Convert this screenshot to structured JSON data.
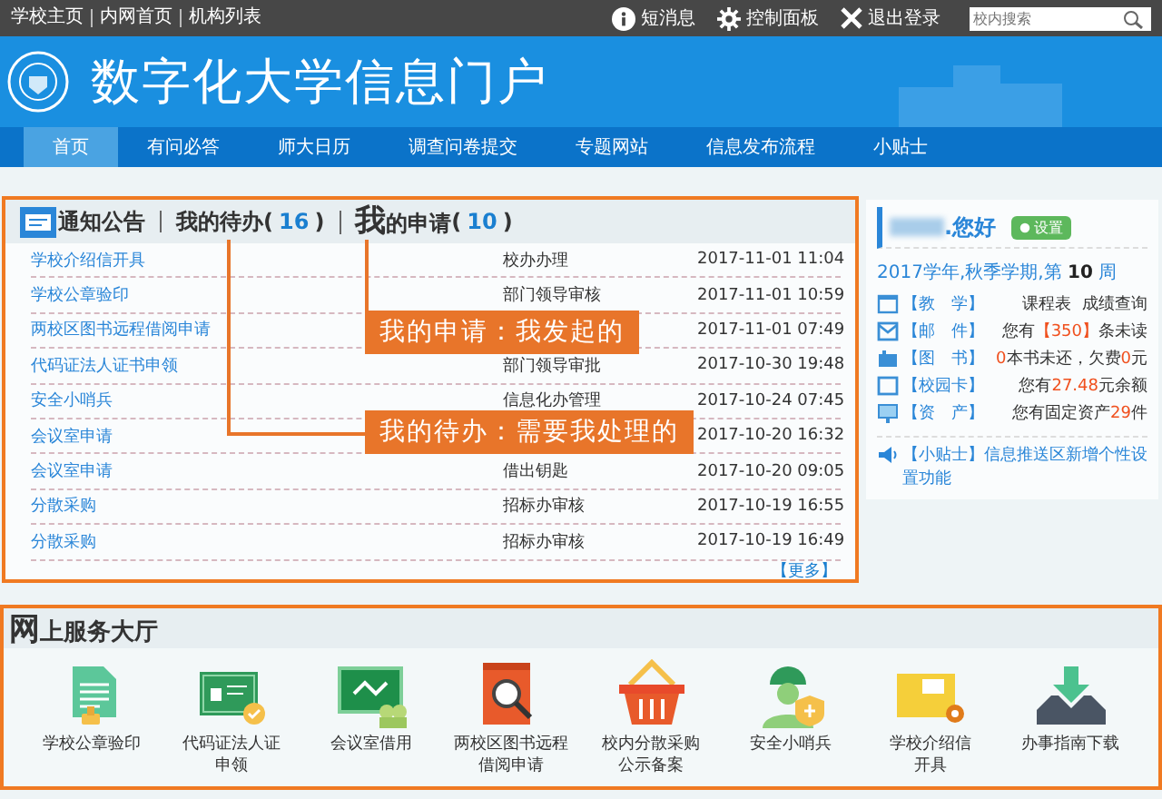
{
  "top_links": [
    "学校主页",
    "内网首页",
    "机构列表"
  ],
  "top_actions": [
    {
      "kind": "info",
      "label": "短消息"
    },
    {
      "kind": "gear",
      "label": "控制面板"
    },
    {
      "kind": "close",
      "label": "退出登录"
    }
  ],
  "search": {
    "placeholder": "校内搜索"
  },
  "banner": {
    "title": "数字化大学信息门户"
  },
  "nav": [
    {
      "label": "首页",
      "selected": true
    },
    {
      "label": "有问必答",
      "selected": false
    },
    {
      "label": "师大日历",
      "selected": false
    },
    {
      "label": "调查问卷提交",
      "selected": false
    },
    {
      "label": "专题网站",
      "selected": false
    },
    {
      "label": "信息发布流程",
      "selected": false
    },
    {
      "label": "小贴士",
      "selected": false
    }
  ],
  "tabs": [
    {
      "label": "通知公告",
      "icon": true,
      "selected": false
    },
    {
      "label": "我的待办",
      "brackets": [
        "(",
        ")"
      ],
      "count": "16",
      "selected": false
    },
    {
      "label": "我的申请",
      "brackets": [
        "(",
        ")"
      ],
      "count": "10",
      "selected": true
    }
  ],
  "rows": [
    {
      "title": "学校介绍信开具",
      "status": "校办办理",
      "time": "2017-11-01 11:04"
    },
    {
      "title": "学校公章验印",
      "status": "部门领导审核",
      "time": "2017-11-01 10:59"
    },
    {
      "title": "两校区图书远程借阅申请",
      "time": "2017-11-01 07:49"
    },
    {
      "title": "代码证法人证书申领",
      "status": "部门领导审批",
      "time": "2017-10-30 19:48"
    },
    {
      "title": "安全小哨兵",
      "status": "信息化办管理",
      "time": "2017-10-24 07:45"
    },
    {
      "title": "会议室申请",
      "time": "2017-10-20 16:32"
    },
    {
      "title": "会议室申请",
      "status": "借出钥匙",
      "time": "2017-10-20 09:05"
    },
    {
      "title": "分散采购",
      "status": "招标办审核",
      "time": "2017-10-19 16:55"
    },
    {
      "title": "分散采购",
      "status": "招标办审核",
      "time": "2017-10-19 16:49"
    }
  ],
  "more": "【更多】",
  "annotations": [
    {
      "text": "我的申请：我发起的"
    },
    {
      "text": "我的待办：需要我处理的"
    }
  ],
  "user": {
    "greeting": ".您好",
    "settings": "设置",
    "term_parts": [
      "2017学年,秋季学期,第 ",
      "10",
      " 周"
    ],
    "items": [
      {
        "kind": "teach",
        "label": "【教　学】",
        "parts": [
          {
            "text": "课程表",
            "highlight": false
          },
          {
            "text": "成绩查询",
            "highlight": false
          }
        ]
      },
      {
        "kind": "mail",
        "label": "【邮　件】",
        "parts": [
          {
            "text": "您有",
            "highlight": false
          },
          {
            "text": "【350】",
            "highlight": true
          },
          {
            "text": "条未读",
            "highlight": false
          }
        ]
      },
      {
        "kind": "book",
        "label": "【图　书】",
        "parts": [
          {
            "text": "0",
            "highlight": true
          },
          {
            "text": "本书未还，欠费",
            "highlight": false
          },
          {
            "text": "0",
            "highlight": true
          },
          {
            "text": "元",
            "highlight": false
          }
        ]
      },
      {
        "kind": "card",
        "label": "【校园卡】",
        "parts": [
          {
            "text": "您有",
            "highlight": false
          },
          {
            "text": "27.48",
            "highlight": true
          },
          {
            "text": "元余额",
            "highlight": false
          }
        ]
      },
      {
        "kind": "asset",
        "label": "【资　产】",
        "parts": [
          {
            "text": "您有固定资产",
            "highlight": false
          },
          {
            "text": "29",
            "highlight": true
          },
          {
            "text": "件",
            "highlight": false
          }
        ]
      }
    ],
    "tip_label": "【小贴士】",
    "tip": "信息推送区新增个性设置功能"
  },
  "services": {
    "title": "网上服务大厅",
    "items": [
      {
        "kind": "document",
        "lines": [
          "学校公章验印"
        ]
      },
      {
        "kind": "certificate",
        "lines": [
          "代码证法人证",
          "申领"
        ]
      },
      {
        "kind": "board",
        "lines": [
          "会议室借用"
        ]
      },
      {
        "kind": "book",
        "lines": [
          "两校区图书远程",
          "借阅申请"
        ]
      },
      {
        "kind": "basket",
        "lines": [
          "校内分散采购",
          "公示备案"
        ]
      },
      {
        "kind": "worker",
        "lines": [
          "安全小哨兵"
        ]
      },
      {
        "kind": "folder",
        "lines": [
          "学校介绍信",
          "开具"
        ]
      },
      {
        "kind": "download",
        "lines": [
          "办事指南下载"
        ]
      }
    ]
  }
}
